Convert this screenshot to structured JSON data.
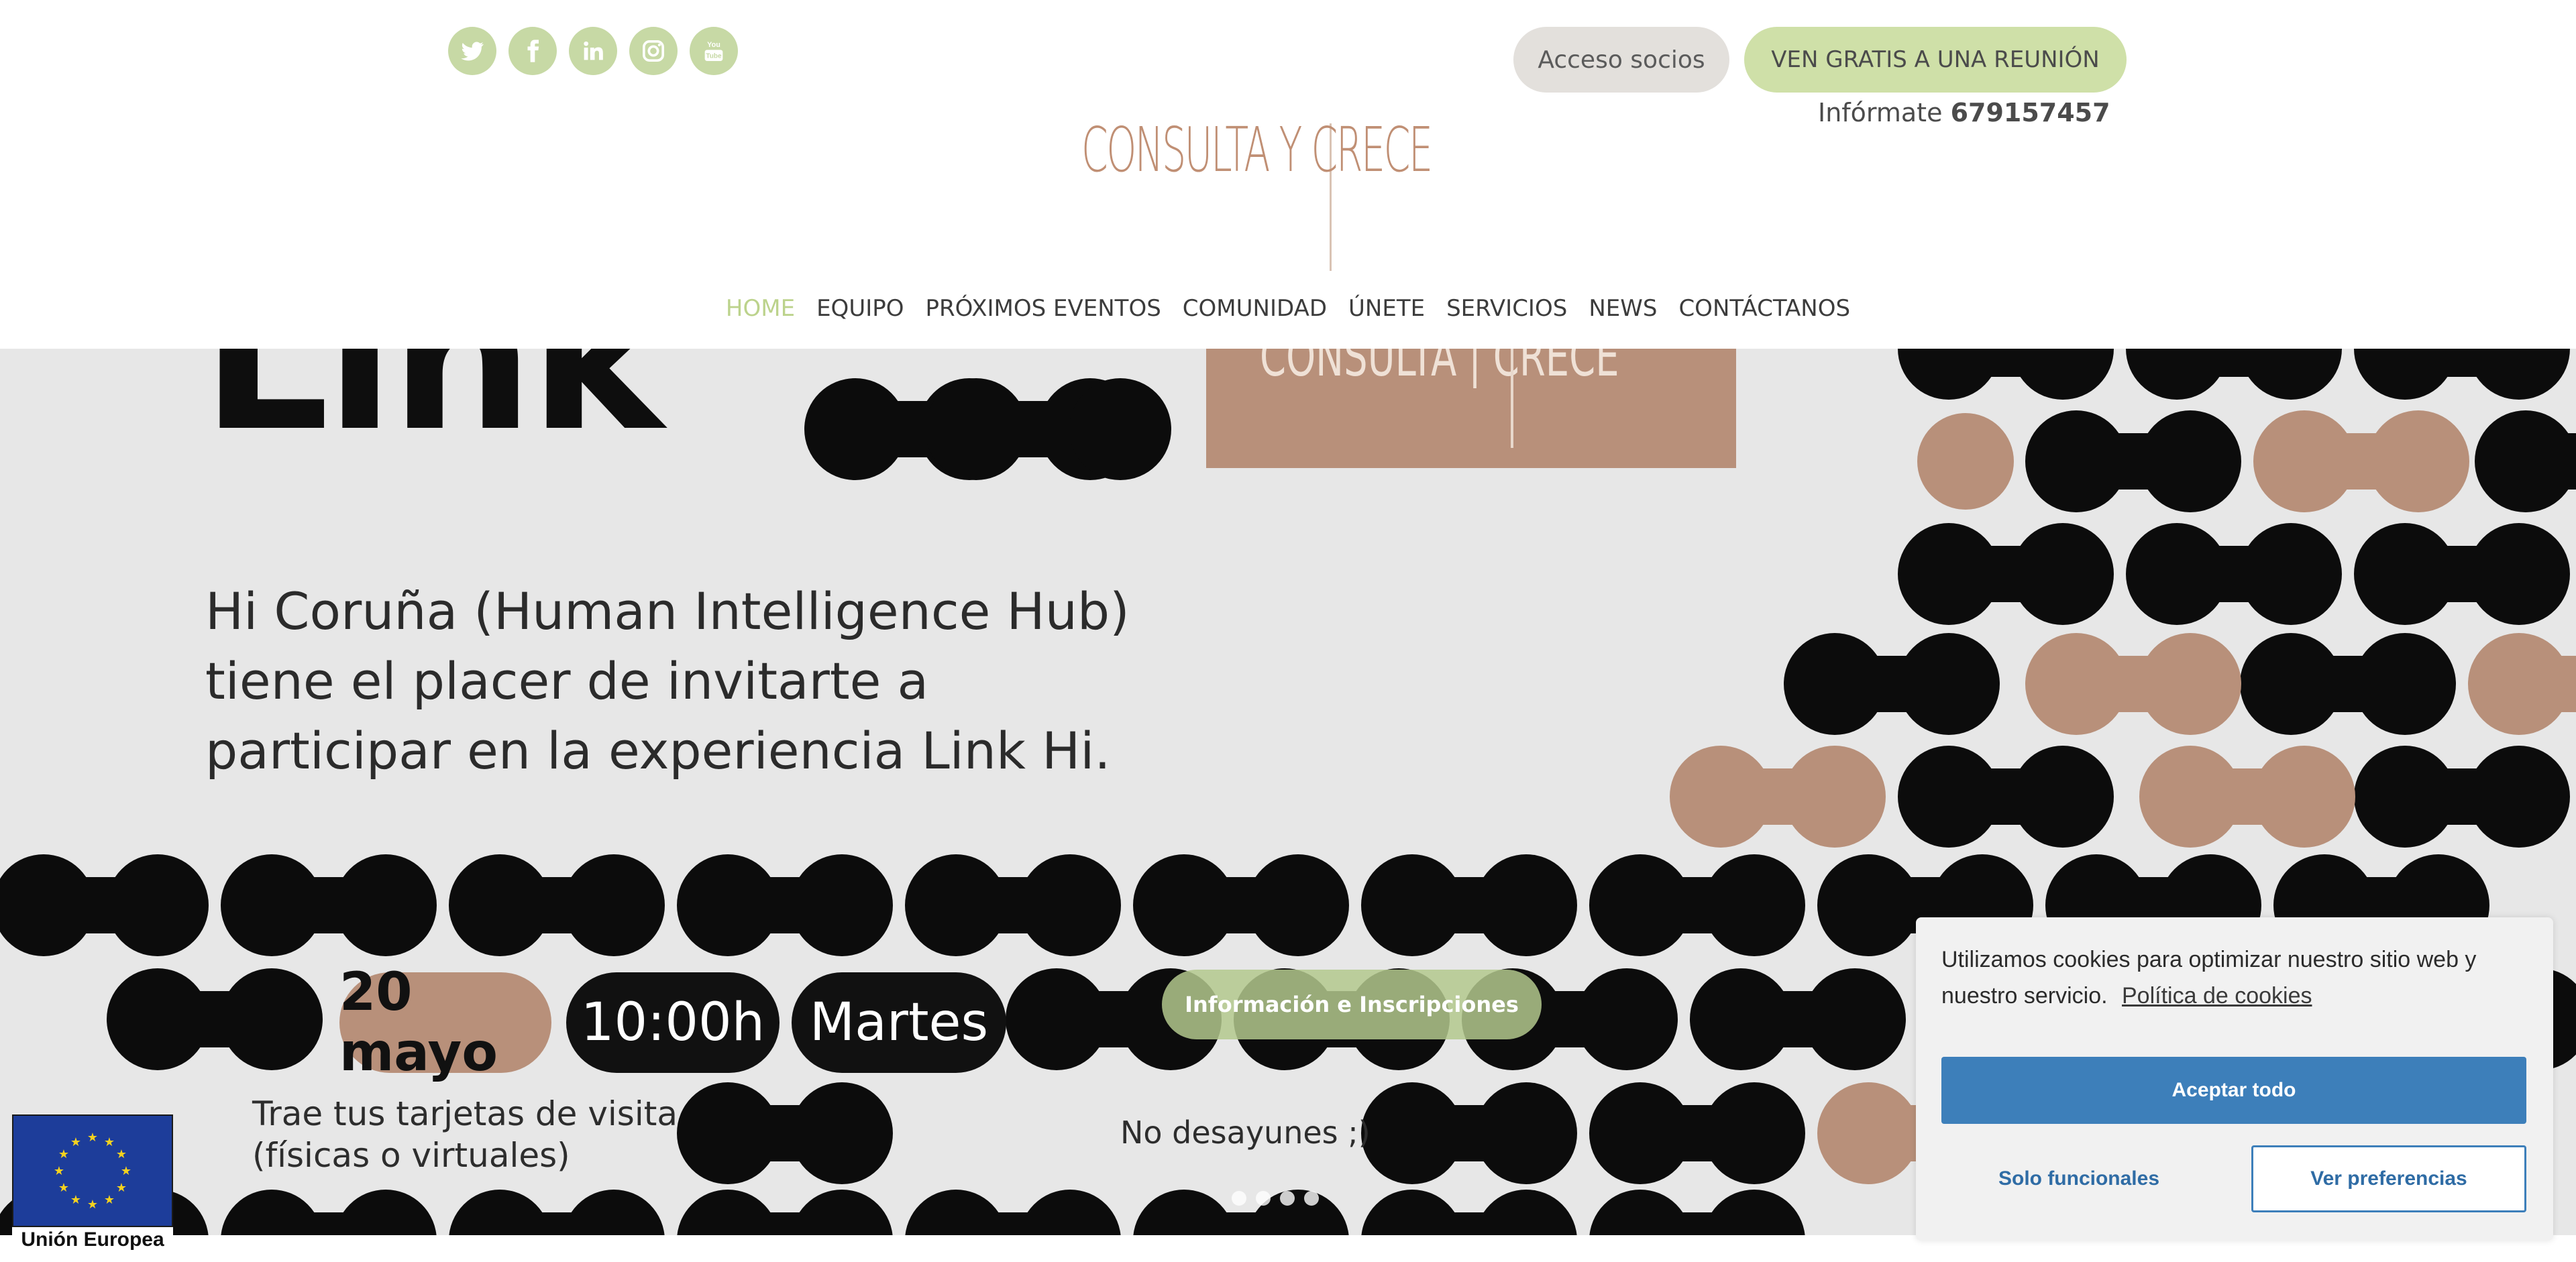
{
  "header": {
    "social": [
      "twitter-icon",
      "facebook-icon",
      "linkedin-icon",
      "instagram-icon",
      "youtube-icon"
    ],
    "login_button": "Acceso socios",
    "meeting_button": "VEN GRATIS A UNA REUNIÓN",
    "info_label": "Infórmate",
    "phone": "679157457",
    "logo_text": "CONSULTA Y CRECE"
  },
  "nav": {
    "items": [
      "HOME",
      "EQUIPO",
      "PRÓXIMOS EVENTOS",
      "COMUNIDAD",
      "ÚNETE",
      "SERVICIOS",
      "NEWS",
      "CONTÁCTANOS"
    ],
    "active": "HOME"
  },
  "hero": {
    "big_word": "Link",
    "tag_text": "CONSULTA | CRECE",
    "lines": [
      "Hi Coruña (Human Intelligence Hub)",
      "tiene el placer de invitarte a",
      "participar en la experiencia Link Hi."
    ],
    "date": "20 mayo",
    "time": "10:00h",
    "day": "Martes",
    "cards_lines": [
      "Trae tus tarjetas de visita",
      "(físicas o virtuales)"
    ],
    "no_breakfast": "No desayunes ;)",
    "cta": "Información e Inscripciones",
    "slide_count": 4
  },
  "eu": {
    "label": "Unión Europea"
  },
  "cookie": {
    "message": "Utilizamos cookies para optimizar nuestro sitio web y nuestro servicio.",
    "policy_link": "Política de cookies",
    "accept": "Aceptar todo",
    "functional": "Solo funcionales",
    "preferences": "Ver preferencias"
  },
  "colors": {
    "accent_green": "#c7d9a5",
    "brand_tan": "#b8907a",
    "cookie_blue": "#3d7fba"
  }
}
